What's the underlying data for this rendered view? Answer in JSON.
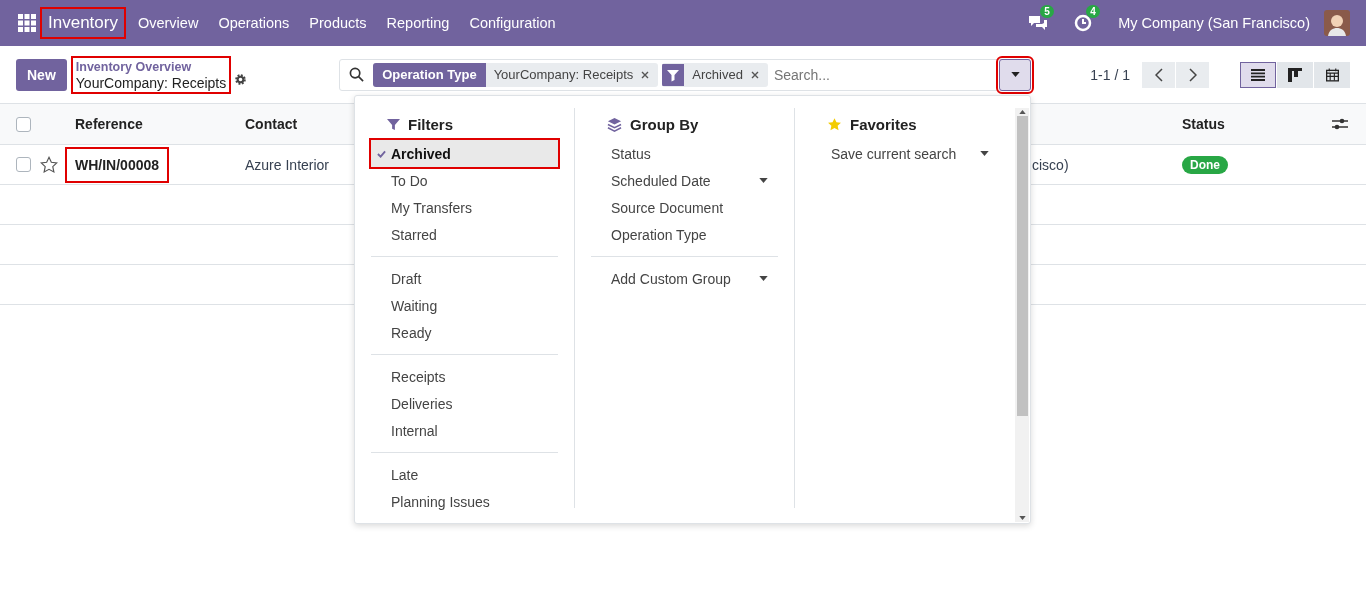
{
  "navbar": {
    "brand": {
      "label": "Inventory",
      "highlighted": true
    },
    "menu": [
      "Overview",
      "Operations",
      "Products",
      "Reporting",
      "Configuration"
    ],
    "messages_badge": "5",
    "activities_badge": "4",
    "company": "My Company (San Francisco)"
  },
  "control_panel": {
    "new_button": "New",
    "breadcrumb": {
      "parent": "Inventory Overview",
      "current": "YourCompany: Receipts",
      "highlighted": true
    },
    "search": {
      "facets": [
        {
          "kind": "field",
          "label": "Operation Type",
          "value": "YourCompany: Receipts"
        },
        {
          "kind": "filter",
          "value": "Archived"
        }
      ],
      "placeholder": "Search...",
      "toggle_highlighted": true
    },
    "pager": "1-1 / 1",
    "views": [
      {
        "kind": "list",
        "selected": true
      },
      {
        "kind": "kanban",
        "selected": false
      },
      {
        "kind": "calendar",
        "selected": false
      }
    ]
  },
  "table": {
    "select_all_checked": false,
    "columns": [
      "Reference",
      "Contact",
      "",
      "Status"
    ],
    "rows": [
      {
        "checked": false,
        "starred": false,
        "reference": "WH/IN/00008",
        "reference_highlighted": true,
        "contact": "Azure Interior",
        "column_3": "cisco)",
        "status": "Done"
      }
    ]
  },
  "dropdown": {
    "filters": {
      "title": "Filters",
      "groups": [
        {
          "items": [
            {
              "label": "Archived",
              "selected": true,
              "highlighted": true
            },
            {
              "label": "To Do",
              "selected": false
            },
            {
              "label": "My Transfers",
              "selected": false
            },
            {
              "label": "Starred",
              "selected": false
            }
          ]
        },
        {
          "items": [
            {
              "label": "Draft",
              "selected": false
            },
            {
              "label": "Waiting",
              "selected": false
            },
            {
              "label": "Ready",
              "selected": false
            }
          ]
        },
        {
          "items": [
            {
              "label": "Receipts",
              "selected": false
            },
            {
              "label": "Deliveries",
              "selected": false
            },
            {
              "label": "Internal",
              "selected": false
            }
          ]
        },
        {
          "items": [
            {
              "label": "Late",
              "selected": false
            },
            {
              "label": "Planning Issues",
              "selected": false
            }
          ]
        }
      ]
    },
    "group_by": {
      "title": "Group By",
      "groups": [
        {
          "items": [
            {
              "label": "Status",
              "submenu": false
            },
            {
              "label": "Scheduled Date",
              "submenu": true
            },
            {
              "label": "Source Document",
              "submenu": false
            },
            {
              "label": "Operation Type",
              "submenu": false
            }
          ]
        },
        {
          "items": [
            {
              "label": "Add Custom Group",
              "submenu": true
            }
          ]
        }
      ]
    },
    "favorites": {
      "title": "Favorites",
      "items": [
        {
          "label": "Save current search",
          "submenu": true
        }
      ]
    }
  }
}
